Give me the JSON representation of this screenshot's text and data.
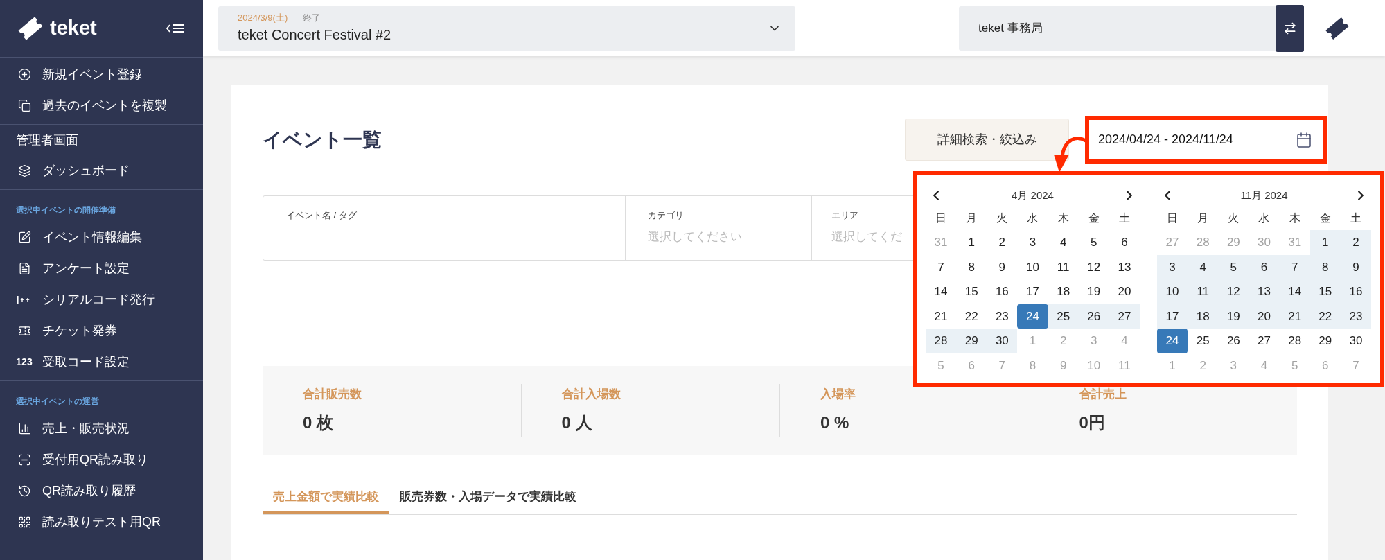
{
  "sidebar": {
    "brand": "teket",
    "sections": [
      {
        "items": [
          {
            "label": "新規イベント登録"
          },
          {
            "label": "過去のイベントを複製"
          }
        ]
      },
      {
        "heading": "管理者画面",
        "caption": false,
        "items": [
          {
            "label": "ダッシュボード"
          }
        ]
      },
      {
        "heading": "選択中イベントの開催準備",
        "caption": true,
        "items": [
          {
            "label": "イベント情報編集"
          },
          {
            "label": "アンケート設定"
          },
          {
            "label": "シリアルコード発行"
          },
          {
            "label": "チケット発券"
          },
          {
            "label": "受取コード設定",
            "icon_text": "123"
          }
        ]
      },
      {
        "heading": "選択中イベントの運営",
        "caption": true,
        "items": [
          {
            "label": "売上・販売状況"
          },
          {
            "label": "受付用QR読み取り"
          },
          {
            "label": "QR読み取り履歴"
          },
          {
            "label": "読み取りテスト用QR"
          }
        ]
      }
    ]
  },
  "header": {
    "event": {
      "date": "2024/3/9(土)",
      "status": "終了",
      "name": "teket Concert Festival #2"
    },
    "organizer": "teket 事務局"
  },
  "page": {
    "title": "イベント一覧",
    "search_button": "詳細検索・絞込み",
    "date_range": "2024/04/24 - 2024/11/24",
    "filters": [
      {
        "label": "イベント名 / タグ"
      },
      {
        "label": "カテゴリ",
        "placeholder": "選択してください"
      },
      {
        "label": "エリア",
        "placeholder": "選択してくだ"
      }
    ],
    "stats": [
      {
        "label": "合計販売数",
        "value": "0 枚"
      },
      {
        "label": "合計入場数",
        "value": "0 人"
      },
      {
        "label": "入場率",
        "value": "0 %"
      },
      {
        "label": "合計売上",
        "value": "0円"
      }
    ],
    "tabs": [
      {
        "label": "売上金額で実績比較",
        "selected": true
      },
      {
        "label": "販売券数・入場データで実績比較",
        "selected": false
      }
    ]
  },
  "calendar": {
    "months": [
      {
        "title": "4月 2024",
        "weekdays": [
          "日",
          "月",
          "火",
          "水",
          "木",
          "金",
          "土"
        ],
        "weeks": [
          [
            {
              "day": "31",
              "in_month": false,
              "in_range": false,
              "selected": false
            },
            {
              "day": "1",
              "in_month": true,
              "in_range": false,
              "selected": false
            },
            {
              "day": "2",
              "in_month": true,
              "in_range": false,
              "selected": false
            },
            {
              "day": "3",
              "in_month": true,
              "in_range": false,
              "selected": false
            },
            {
              "day": "4",
              "in_month": true,
              "in_range": false,
              "selected": false
            },
            {
              "day": "5",
              "in_month": true,
              "in_range": false,
              "selected": false
            },
            {
              "day": "6",
              "in_month": true,
              "in_range": false,
              "selected": false
            }
          ],
          [
            {
              "day": "7",
              "in_month": true,
              "in_range": false,
              "selected": false
            },
            {
              "day": "8",
              "in_month": true,
              "in_range": false,
              "selected": false
            },
            {
              "day": "9",
              "in_month": true,
              "in_range": false,
              "selected": false
            },
            {
              "day": "10",
              "in_month": true,
              "in_range": false,
              "selected": false
            },
            {
              "day": "11",
              "in_month": true,
              "in_range": false,
              "selected": false
            },
            {
              "day": "12",
              "in_month": true,
              "in_range": false,
              "selected": false
            },
            {
              "day": "13",
              "in_month": true,
              "in_range": false,
              "selected": false
            }
          ],
          [
            {
              "day": "14",
              "in_month": true,
              "in_range": false,
              "selected": false
            },
            {
              "day": "15",
              "in_month": true,
              "in_range": false,
              "selected": false
            },
            {
              "day": "16",
              "in_month": true,
              "in_range": false,
              "selected": false
            },
            {
              "day": "17",
              "in_month": true,
              "in_range": false,
              "selected": false
            },
            {
              "day": "18",
              "in_month": true,
              "in_range": false,
              "selected": false
            },
            {
              "day": "19",
              "in_month": true,
              "in_range": false,
              "selected": false
            },
            {
              "day": "20",
              "in_month": true,
              "in_range": false,
              "selected": false
            }
          ],
          [
            {
              "day": "21",
              "in_month": true,
              "in_range": false,
              "selected": false
            },
            {
              "day": "22",
              "in_month": true,
              "in_range": false,
              "selected": false
            },
            {
              "day": "23",
              "in_month": true,
              "in_range": false,
              "selected": false
            },
            {
              "day": "24",
              "in_month": true,
              "in_range": true,
              "selected": true
            },
            {
              "day": "25",
              "in_month": true,
              "in_range": true,
              "selected": false
            },
            {
              "day": "26",
              "in_month": true,
              "in_range": true,
              "selected": false
            },
            {
              "day": "27",
              "in_month": true,
              "in_range": true,
              "selected": false
            }
          ],
          [
            {
              "day": "28",
              "in_month": true,
              "in_range": true,
              "selected": false
            },
            {
              "day": "29",
              "in_month": true,
              "in_range": true,
              "selected": false
            },
            {
              "day": "30",
              "in_month": true,
              "in_range": true,
              "selected": false
            },
            {
              "day": "1",
              "in_month": false,
              "in_range": false,
              "selected": false
            },
            {
              "day": "2",
              "in_month": false,
              "in_range": false,
              "selected": false
            },
            {
              "day": "3",
              "in_month": false,
              "in_range": false,
              "selected": false
            },
            {
              "day": "4",
              "in_month": false,
              "in_range": false,
              "selected": false
            }
          ],
          [
            {
              "day": "5",
              "in_month": false,
              "in_range": false,
              "selected": false
            },
            {
              "day": "6",
              "in_month": false,
              "in_range": false,
              "selected": false
            },
            {
              "day": "7",
              "in_month": false,
              "in_range": false,
              "selected": false
            },
            {
              "day": "8",
              "in_month": false,
              "in_range": false,
              "selected": false
            },
            {
              "day": "9",
              "in_month": false,
              "in_range": false,
              "selected": false
            },
            {
              "day": "10",
              "in_month": false,
              "in_range": false,
              "selected": false
            },
            {
              "day": "11",
              "in_month": false,
              "in_range": false,
              "selected": false
            }
          ]
        ]
      },
      {
        "title": "11月 2024",
        "weekdays": [
          "日",
          "月",
          "火",
          "水",
          "木",
          "金",
          "土"
        ],
        "weeks": [
          [
            {
              "day": "27",
              "in_month": false,
              "in_range": false,
              "selected": false
            },
            {
              "day": "28",
              "in_month": false,
              "in_range": false,
              "selected": false
            },
            {
              "day": "29",
              "in_month": false,
              "in_range": false,
              "selected": false
            },
            {
              "day": "30",
              "in_month": false,
              "in_range": false,
              "selected": false
            },
            {
              "day": "31",
              "in_month": false,
              "in_range": false,
              "selected": false
            },
            {
              "day": "1",
              "in_month": true,
              "in_range": true,
              "selected": false
            },
            {
              "day": "2",
              "in_month": true,
              "in_range": true,
              "selected": false
            }
          ],
          [
            {
              "day": "3",
              "in_month": true,
              "in_range": true,
              "selected": false
            },
            {
              "day": "4",
              "in_month": true,
              "in_range": true,
              "selected": false
            },
            {
              "day": "5",
              "in_month": true,
              "in_range": true,
              "selected": false
            },
            {
              "day": "6",
              "in_month": true,
              "in_range": true,
              "selected": false
            },
            {
              "day": "7",
              "in_month": true,
              "in_range": true,
              "selected": false
            },
            {
              "day": "8",
              "in_month": true,
              "in_range": true,
              "selected": false
            },
            {
              "day": "9",
              "in_month": true,
              "in_range": true,
              "selected": false
            }
          ],
          [
            {
              "day": "10",
              "in_month": true,
              "in_range": true,
              "selected": false
            },
            {
              "day": "11",
              "in_month": true,
              "in_range": true,
              "selected": false
            },
            {
              "day": "12",
              "in_month": true,
              "in_range": true,
              "selected": false
            },
            {
              "day": "13",
              "in_month": true,
              "in_range": true,
              "selected": false
            },
            {
              "day": "14",
              "in_month": true,
              "in_range": true,
              "selected": false
            },
            {
              "day": "15",
              "in_month": true,
              "in_range": true,
              "selected": false
            },
            {
              "day": "16",
              "in_month": true,
              "in_range": true,
              "selected": false
            }
          ],
          [
            {
              "day": "17",
              "in_month": true,
              "in_range": true,
              "selected": false
            },
            {
              "day": "18",
              "in_month": true,
              "in_range": true,
              "selected": false
            },
            {
              "day": "19",
              "in_month": true,
              "in_range": true,
              "selected": false
            },
            {
              "day": "20",
              "in_month": true,
              "in_range": true,
              "selected": false
            },
            {
              "day": "21",
              "in_month": true,
              "in_range": true,
              "selected": false
            },
            {
              "day": "22",
              "in_month": true,
              "in_range": true,
              "selected": false
            },
            {
              "day": "23",
              "in_month": true,
              "in_range": true,
              "selected": false
            }
          ],
          [
            {
              "day": "24",
              "in_month": true,
              "in_range": true,
              "selected": true
            },
            {
              "day": "25",
              "in_month": true,
              "in_range": false,
              "selected": false
            },
            {
              "day": "26",
              "in_month": true,
              "in_range": false,
              "selected": false
            },
            {
              "day": "27",
              "in_month": true,
              "in_range": false,
              "selected": false
            },
            {
              "day": "28",
              "in_month": true,
              "in_range": false,
              "selected": false
            },
            {
              "day": "29",
              "in_month": true,
              "in_range": false,
              "selected": false
            },
            {
              "day": "30",
              "in_month": true,
              "in_range": false,
              "selected": false
            }
          ],
          [
            {
              "day": "1",
              "in_month": false,
              "in_range": false,
              "selected": false
            },
            {
              "day": "2",
              "in_month": false,
              "in_range": false,
              "selected": false
            },
            {
              "day": "3",
              "in_month": false,
              "in_range": false,
              "selected": false
            },
            {
              "day": "4",
              "in_month": false,
              "in_range": false,
              "selected": false
            },
            {
              "day": "5",
              "in_month": false,
              "in_range": false,
              "selected": false
            },
            {
              "day": "6",
              "in_month": false,
              "in_range": false,
              "selected": false
            },
            {
              "day": "7",
              "in_month": false,
              "in_range": false,
              "selected": false
            }
          ]
        ]
      }
    ]
  }
}
